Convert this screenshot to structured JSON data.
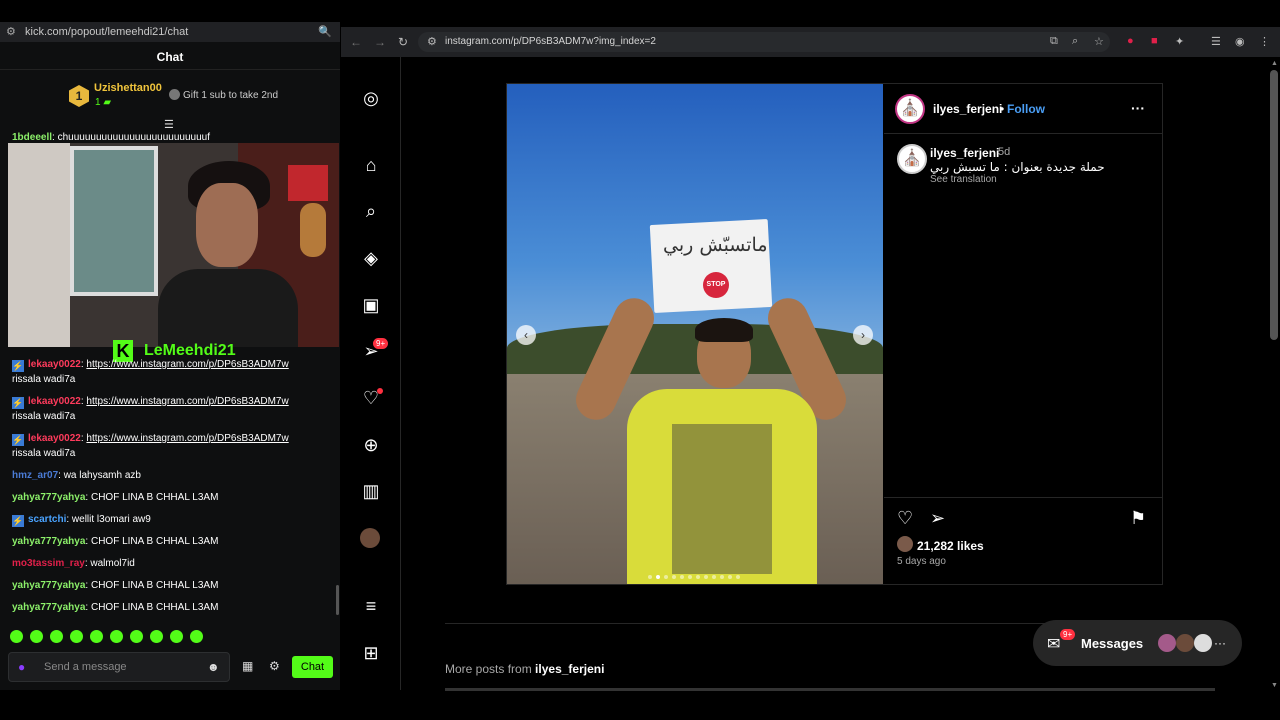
{
  "kick": {
    "url": "kick.com/popout/lemeehdi21/chat",
    "chat_title": "Chat",
    "pinned": {
      "rank": "1",
      "gifter": "Uzishettan00",
      "count": "1",
      "cta": "Gift 1 sub to take 2nd"
    },
    "top_message": {
      "user": "1bdeeell",
      "text": "chuuuuuuuuuuuuuuuuuuuuuuuuuf"
    },
    "streamer": "LeMeehdi21",
    "messages": [
      {
        "user": "lekaay0022",
        "user_color": "#ff3b5c",
        "text": "https://www.instagram.com/p/DP6sB3ADM7w",
        "cont": "rissala wadi7a"
      },
      {
        "user": "lekaay0022",
        "user_color": "#ff3b5c",
        "text": "https://www.instagram.com/p/DP6sB3ADM7w",
        "cont": "rissala wadi7a"
      },
      {
        "user": "lekaay0022",
        "user_color": "#ff3b5c",
        "text": "https://www.instagram.com/p/DP6sB3ADM7w",
        "cont": "rissala wadi7a"
      },
      {
        "user": "hmz_ar07",
        "user_color": "#4a7bd5",
        "text": "wa lahysamh azb"
      },
      {
        "user": "yahya777yahya",
        "user_color": "#8cf06a",
        "text": "CHOF LINA B CHHAL L3AM"
      },
      {
        "user": "scartchi",
        "user_color": "#4aa3ff",
        "text": "wellit l3omari aw9"
      },
      {
        "user": "yahya777yahya",
        "user_color": "#8cf06a",
        "text": "CHOF LINA B CHHAL L3AM"
      },
      {
        "user": "mo3tassim_ray",
        "user_color": "#e0204a",
        "text": "walmol7id"
      },
      {
        "user": "yahya777yahya",
        "user_color": "#8cf06a",
        "text": "CHOF LINA B CHHAL L3AM"
      },
      {
        "user": "yahya777yahya",
        "user_color": "#8cf06a",
        "text": "CHOF LINA B CHHAL L3AM"
      }
    ],
    "input_placeholder": "Send a message",
    "chat_button": "Chat"
  },
  "browser": {
    "url": "instagram.com/p/DP6sB3ADM7w?img_index=2"
  },
  "instagram": {
    "notif_count": "9+",
    "post": {
      "author": "ilyes_ferjeni",
      "separator": "•",
      "follow": "Follow",
      "caption_author": "ilyes_ferjeni",
      "caption_time": "5d",
      "caption": "حملة جديدة بعنوان : ما تسبش ربي",
      "see_translation": "See translation",
      "sign_text": "ماتسبّش ربي",
      "sign_stop": "STOP",
      "likes": "21,282 likes",
      "ago": "5 days ago",
      "carousel_total": 12,
      "carousel_index": 2
    },
    "more_posts_prefix": "More posts from",
    "more_posts_user": "ilyes_ferjeni",
    "messages_label": "Messages",
    "messages_badge": "9+"
  }
}
